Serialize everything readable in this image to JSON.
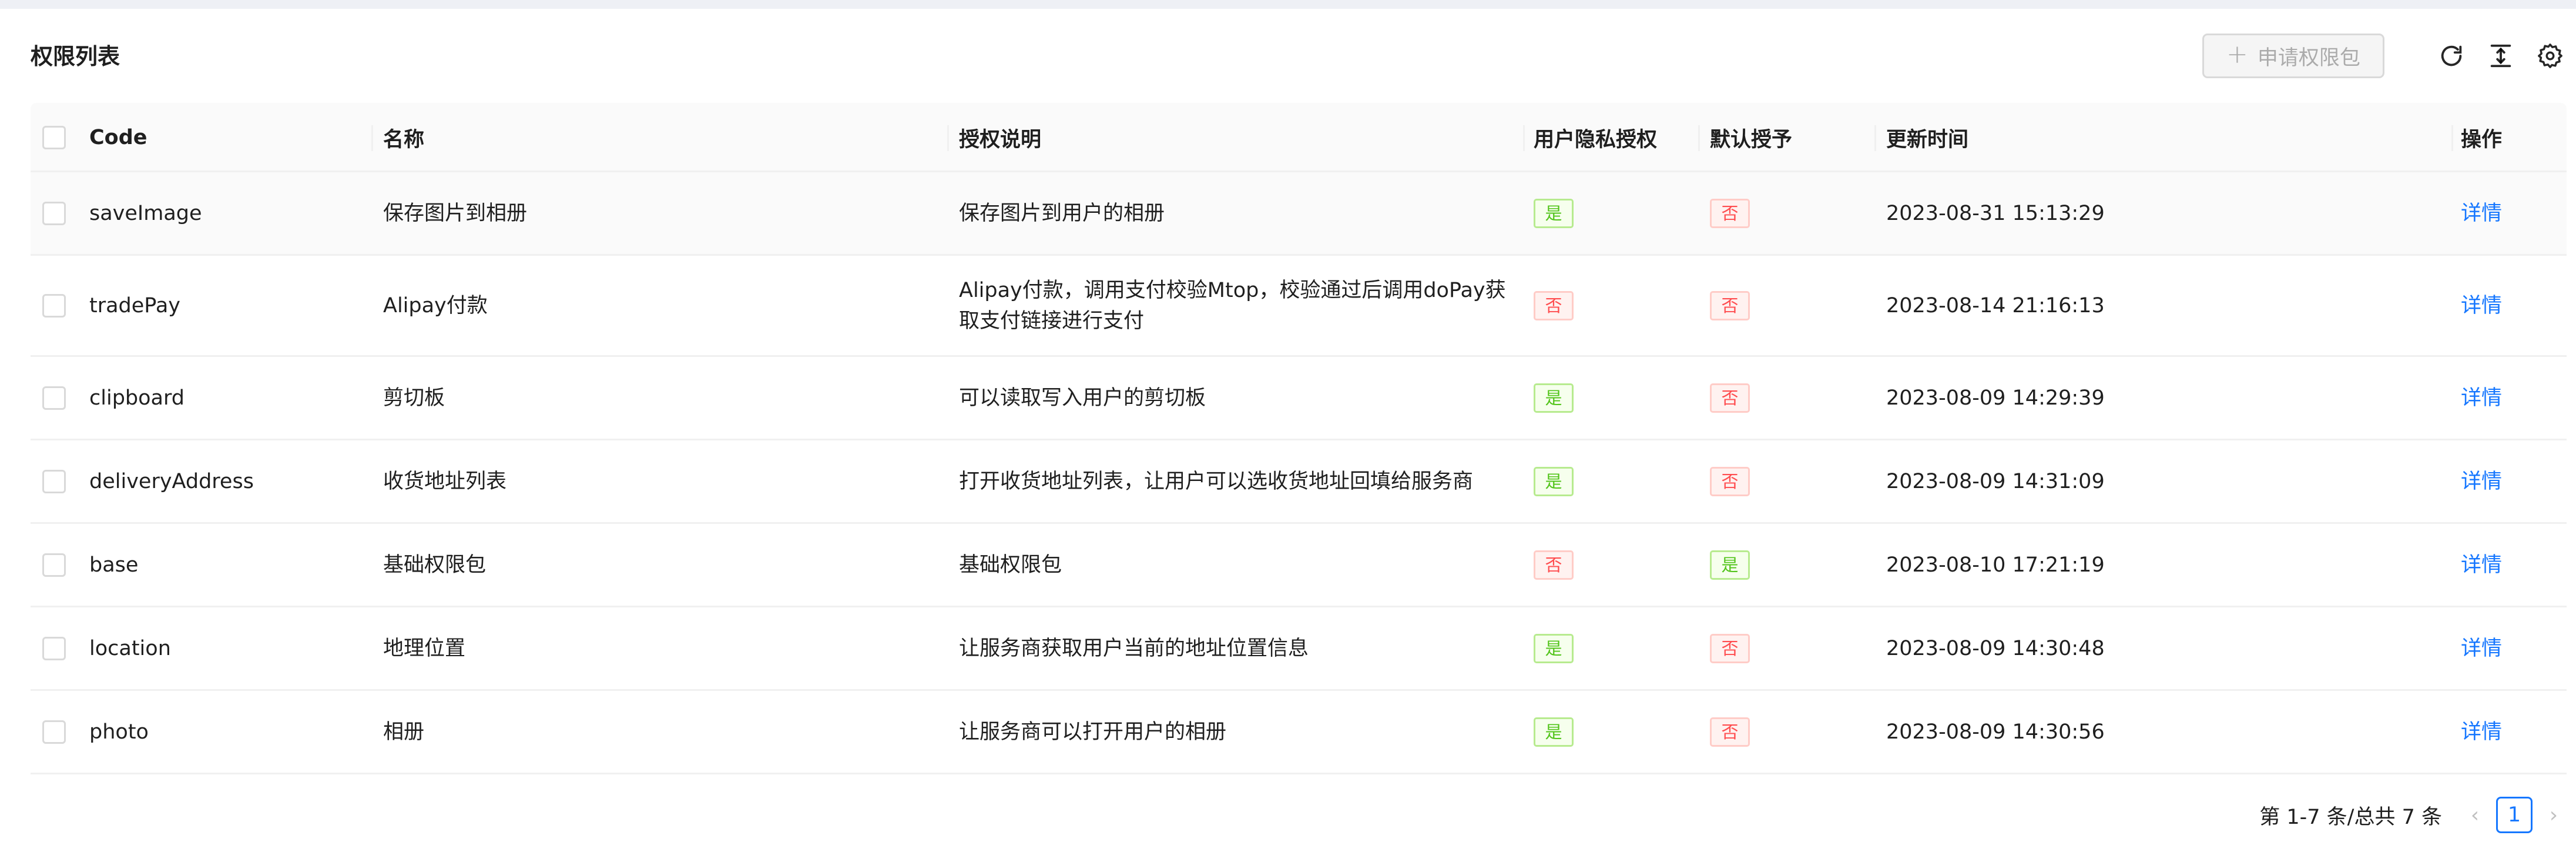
{
  "card": {
    "title": "权限列表",
    "apply_button_label": "申请权限包"
  },
  "toolbar_icons": [
    "reload-icon",
    "density-icon",
    "settings-icon"
  ],
  "table": {
    "columns": [
      "Code",
      "名称",
      "授权说明",
      "用户隐私授权",
      "默认授予",
      "更新时间",
      "操作"
    ],
    "rows": [
      {
        "code": "saveImage",
        "name": "保存图片到相册",
        "desc_lines": [
          "保存图片到用户的相册"
        ],
        "privacy": "是",
        "default": "否",
        "updated": "2023-08-31 15:13:29",
        "action": "详情"
      },
      {
        "code": "tradePay",
        "name": "Alipay付款",
        "desc_lines": [
          "Alipay付款，调用支付校验Mtop，校验通过后调用doPay获",
          "取支付链接进行支付"
        ],
        "privacy": "否",
        "default": "否",
        "updated": "2023-08-14 21:16:13",
        "action": "详情"
      },
      {
        "code": "clipboard",
        "name": "剪切板",
        "desc_lines": [
          "可以读取写入用户的剪切板"
        ],
        "privacy": "是",
        "default": "否",
        "updated": "2023-08-09 14:29:39",
        "action": "详情"
      },
      {
        "code": "deliveryAddress",
        "name": "收货地址列表",
        "desc_lines": [
          "打开收货地址列表，让用户可以选收货地址回填给服务商"
        ],
        "privacy": "是",
        "default": "否",
        "updated": "2023-08-09 14:31:09",
        "action": "详情"
      },
      {
        "code": "base",
        "name": "基础权限包",
        "desc_lines": [
          "基础权限包"
        ],
        "privacy": "否",
        "default": "是",
        "updated": "2023-08-10 17:21:19",
        "action": "详情"
      },
      {
        "code": "location",
        "name": "地理位置",
        "desc_lines": [
          "让服务商获取用户当前的地址位置信息"
        ],
        "privacy": "是",
        "default": "否",
        "updated": "2023-08-09 14:30:48",
        "action": "详情"
      },
      {
        "code": "photo",
        "name": "相册",
        "desc_lines": [
          "让服务商可以打开用户的相册"
        ],
        "privacy": "是",
        "default": "否",
        "updated": "2023-08-09 14:30:56",
        "action": "详情"
      }
    ]
  },
  "pagination": {
    "total_text": "第 1-7 条/总共 7 条",
    "current_page": "1"
  },
  "colors": {
    "primary": "#1677ff",
    "success": "#52c41a",
    "error": "#ff4d4f",
    "header_bg": "#fafafa"
  }
}
